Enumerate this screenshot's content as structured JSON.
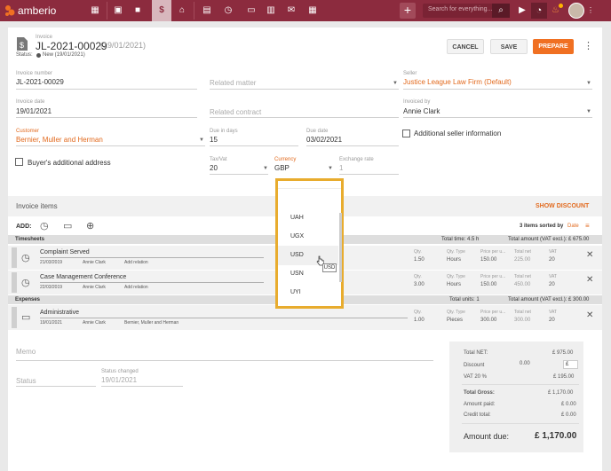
{
  "colors": {
    "brand": "#8c2b3e",
    "accent": "#f07022",
    "link": "#e26a1e",
    "highlight": "#e8ac2e"
  },
  "topbar": {
    "brand": "amberio",
    "search_placeholder": "Search for everything..."
  },
  "header": {
    "doc_type": "Invoice",
    "number": "JL-2021-00029",
    "date_paren": "(19/01/2021)",
    "status_label": "Status:",
    "status": "New (19/01/2021)",
    "cancel": "CANCEL",
    "save": "SAVE",
    "prepare": "PREPARE"
  },
  "form": {
    "invoice_number_label": "Invoice number",
    "invoice_number": "JL-2021-00029",
    "related_matter": "Related matter",
    "seller_label": "Seller",
    "seller": "Justice League Law Firm (Default)",
    "invoice_date_label": "Invoice date",
    "invoice_date": "19/01/2021",
    "related_contract": "Related contract",
    "invoiced_by_label": "Invoiced by",
    "invoiced_by": "Annie Clark",
    "customer_label": "Customer",
    "customer": "Bernier, Muller and Herman",
    "due_days_label": "Due in days",
    "due_days": "15",
    "due_date_label": "Due date",
    "due_date": "03/02/2021",
    "additional_seller": "Additional seller information",
    "buyer_additional": "Buyer's additional address",
    "tax_label": "Tax/Vat",
    "tax": "20",
    "currency_label": "Currency",
    "currency": "GBP",
    "exchange_label": "Exchange rate",
    "exchange": "1"
  },
  "currency_dropdown": {
    "options": [
      "UAH",
      "UGX",
      "USD",
      "USN",
      "UYI"
    ],
    "tooltip": "USD"
  },
  "items": {
    "title": "Invoice items",
    "show_discount": "SHOW DISCOUNT",
    "add": "ADD:",
    "sort_info": "3 items sorted by",
    "sort_by": "Date"
  },
  "timesheets": {
    "label": "Timesheets",
    "total_time": "Total time: 4.5 h",
    "total_amount": "Total amount (VAT excl.): £ 675.00",
    "rows": [
      {
        "title": "Complaint Served",
        "date": "21/03/2019",
        "user": "Annie Clark",
        "relation": "Add relation",
        "qty": "1.50",
        "qty_type": "Hours",
        "price": "150.00",
        "total": "225.00",
        "vat": "20"
      },
      {
        "title": "Case Management Conference",
        "date": "22/03/2019",
        "user": "Annie Clark",
        "relation": "Add relation",
        "qty": "3.00",
        "qty_type": "Hours",
        "price": "150.00",
        "total": "450.00",
        "vat": "20"
      }
    ]
  },
  "expenses": {
    "label": "Expenses",
    "total_units": "Total units: 1",
    "total_amount": "Total amount (VAT excl.): £ 300.00",
    "rows": [
      {
        "title": "Administrative",
        "date": "19/01/2021",
        "user": "Annie Clark",
        "relation": "Bernier, Muller and Herman",
        "qty": "1.00",
        "qty_type": "Pieces",
        "price": "300.00",
        "total": "300.00",
        "vat": "20"
      }
    ]
  },
  "col_labels": {
    "qty": "Qty.",
    "qty_type": "Qty. Type",
    "price": "Price per u...",
    "total": "Total net",
    "vat": "VAT"
  },
  "footer": {
    "memo": "Memo",
    "status": "Status",
    "status_changed_label": "Status changed",
    "status_changed": "19/01/2021"
  },
  "totals": {
    "net_label": "Total NET:",
    "net": "£ 975.00",
    "discount_label": "Discount",
    "discount": "0.00",
    "discount_unit": "£",
    "vat_label": "VAT 20 %",
    "vat": "£ 195.00",
    "gross_label": "Total Gross:",
    "gross": "£ 1,170.00",
    "paid_label": "Amount paid:",
    "paid": "£ 0.00",
    "credit_label": "Credit total:",
    "credit": "£ 0.00",
    "due_label": "Amount due:",
    "due": "£ 1,170.00"
  }
}
